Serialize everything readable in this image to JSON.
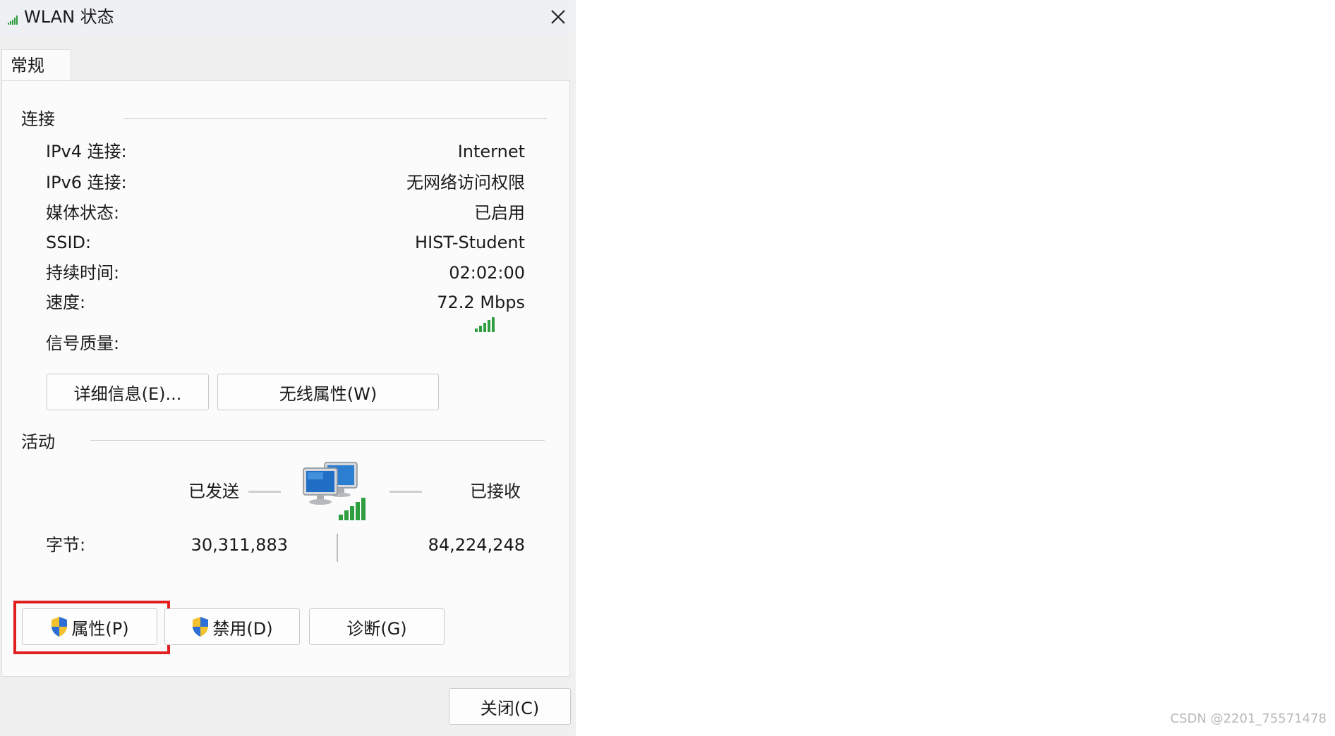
{
  "window": {
    "title": "WLAN 状态"
  },
  "tabs": [
    {
      "label": "常规"
    }
  ],
  "connection": {
    "group_label": "连接",
    "rows": [
      {
        "label": "IPv4 连接:",
        "value": "Internet"
      },
      {
        "label": "IPv6 连接:",
        "value": "无网络访问权限"
      },
      {
        "label": "媒体状态:",
        "value": "已启用"
      },
      {
        "label": "SSID:",
        "value": "HIST-Student"
      },
      {
        "label": "持续时间:",
        "value": "02:02:00"
      },
      {
        "label": "速度:",
        "value": "72.2 Mbps"
      }
    ],
    "signal_label": "信号质量:",
    "signal_bars": 5,
    "signal_color": "#2e9e3e",
    "details_button": "详细信息(E)...",
    "wireless_button": "无线属性(W)"
  },
  "activity": {
    "group_label": "活动",
    "sent_label": "已发送",
    "received_label": "已接收",
    "bytes_label": "字节:",
    "bytes_sent": "30,311,883",
    "bytes_received": "84,224,248"
  },
  "actions": {
    "properties_button": "属性(P)",
    "disable_button": "禁用(D)",
    "diagnose_button": "诊断(G)",
    "highlight_color": "#e02020"
  },
  "footer": {
    "close_button": "关闭(C)"
  },
  "watermark": "CSDN @2201_75571478"
}
